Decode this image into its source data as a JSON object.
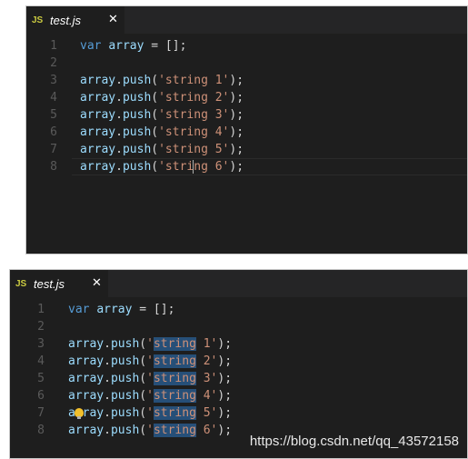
{
  "editors": [
    {
      "tab": {
        "badge": "JS",
        "filename": "test.js",
        "close": "✕"
      },
      "lines": [
        {
          "n": "1",
          "code": [
            {
              "t": "var",
              "c": "kw"
            },
            {
              "t": " ",
              "c": "p"
            },
            {
              "t": "array",
              "c": "id"
            },
            {
              "t": " = [];",
              "c": "p"
            }
          ]
        },
        {
          "n": "2",
          "code": []
        },
        {
          "n": "3",
          "code": [
            {
              "t": "array",
              "c": "id"
            },
            {
              "t": ".",
              "c": "p"
            },
            {
              "t": "push",
              "c": "id"
            },
            {
              "t": "(",
              "c": "p"
            },
            {
              "t": "'string 1'",
              "c": "str"
            },
            {
              "t": ");",
              "c": "p"
            }
          ]
        },
        {
          "n": "4",
          "code": [
            {
              "t": "array",
              "c": "id"
            },
            {
              "t": ".",
              "c": "p"
            },
            {
              "t": "push",
              "c": "id"
            },
            {
              "t": "(",
              "c": "p"
            },
            {
              "t": "'string 2'",
              "c": "str"
            },
            {
              "t": ");",
              "c": "p"
            }
          ]
        },
        {
          "n": "5",
          "code": [
            {
              "t": "array",
              "c": "id"
            },
            {
              "t": ".",
              "c": "p"
            },
            {
              "t": "push",
              "c": "id"
            },
            {
              "t": "(",
              "c": "p"
            },
            {
              "t": "'string 3'",
              "c": "str"
            },
            {
              "t": ");",
              "c": "p"
            }
          ]
        },
        {
          "n": "6",
          "code": [
            {
              "t": "array",
              "c": "id"
            },
            {
              "t": ".",
              "c": "p"
            },
            {
              "t": "push",
              "c": "id"
            },
            {
              "t": "(",
              "c": "p"
            },
            {
              "t": "'string 4'",
              "c": "str"
            },
            {
              "t": ");",
              "c": "p"
            }
          ]
        },
        {
          "n": "7",
          "code": [
            {
              "t": "array",
              "c": "id"
            },
            {
              "t": ".",
              "c": "p"
            },
            {
              "t": "push",
              "c": "id"
            },
            {
              "t": "(",
              "c": "p"
            },
            {
              "t": "'string 5'",
              "c": "str"
            },
            {
              "t": ");",
              "c": "p"
            }
          ]
        },
        {
          "n": "8",
          "code": [
            {
              "t": "array",
              "c": "id"
            },
            {
              "t": ".",
              "c": "p"
            },
            {
              "t": "push",
              "c": "id"
            },
            {
              "t": "(",
              "c": "p"
            },
            {
              "t": "'string 6'",
              "c": "str"
            },
            {
              "t": ");",
              "c": "p"
            }
          ]
        }
      ],
      "current_line": 8
    },
    {
      "tab": {
        "badge": "JS",
        "filename": "test.js",
        "close": "✕"
      },
      "lines": [
        {
          "n": "1",
          "code": [
            {
              "t": "var",
              "c": "kw"
            },
            {
              "t": " ",
              "c": "p"
            },
            {
              "t": "array",
              "c": "id"
            },
            {
              "t": " = [];",
              "c": "p"
            }
          ]
        },
        {
          "n": "2",
          "code": []
        },
        {
          "n": "3",
          "code": [
            {
              "t": "array",
              "c": "id"
            },
            {
              "t": ".",
              "c": "p"
            },
            {
              "t": "push",
              "c": "id"
            },
            {
              "t": "(",
              "c": "p"
            },
            {
              "t": "'",
              "c": "str"
            },
            {
              "t": "string",
              "c": "str sel"
            },
            {
              "t": " 1'",
              "c": "str"
            },
            {
              "t": ");",
              "c": "p"
            }
          ]
        },
        {
          "n": "4",
          "code": [
            {
              "t": "array",
              "c": "id"
            },
            {
              "t": ".",
              "c": "p"
            },
            {
              "t": "push",
              "c": "id"
            },
            {
              "t": "(",
              "c": "p"
            },
            {
              "t": "'",
              "c": "str"
            },
            {
              "t": "string",
              "c": "str sel"
            },
            {
              "t": " 2'",
              "c": "str"
            },
            {
              "t": ");",
              "c": "p"
            }
          ]
        },
        {
          "n": "5",
          "code": [
            {
              "t": "array",
              "c": "id"
            },
            {
              "t": ".",
              "c": "p"
            },
            {
              "t": "push",
              "c": "id"
            },
            {
              "t": "(",
              "c": "p"
            },
            {
              "t": "'",
              "c": "str"
            },
            {
              "t": "string",
              "c": "str sel"
            },
            {
              "t": " 3'",
              "c": "str"
            },
            {
              "t": ");",
              "c": "p"
            }
          ]
        },
        {
          "n": "6",
          "code": [
            {
              "t": "array",
              "c": "id"
            },
            {
              "t": ".",
              "c": "p"
            },
            {
              "t": "push",
              "c": "id"
            },
            {
              "t": "(",
              "c": "p"
            },
            {
              "t": "'",
              "c": "str"
            },
            {
              "t": "string",
              "c": "str sel"
            },
            {
              "t": " 4'",
              "c": "str"
            },
            {
              "t": ");",
              "c": "p"
            }
          ]
        },
        {
          "n": "7",
          "code": [
            {
              "t": "array",
              "c": "id"
            },
            {
              "t": ".",
              "c": "p"
            },
            {
              "t": "push",
              "c": "id"
            },
            {
              "t": "(",
              "c": "p"
            },
            {
              "t": "'",
              "c": "str"
            },
            {
              "t": "string",
              "c": "str sel"
            },
            {
              "t": " 5'",
              "c": "str"
            },
            {
              "t": ");",
              "c": "p"
            }
          ]
        },
        {
          "n": "8",
          "code": [
            {
              "t": "array",
              "c": "id"
            },
            {
              "t": ".",
              "c": "p"
            },
            {
              "t": "push",
              "c": "id"
            },
            {
              "t": "(",
              "c": "p"
            },
            {
              "t": "'",
              "c": "str"
            },
            {
              "t": "string",
              "c": "str sel"
            },
            {
              "t": " 6'",
              "c": "str"
            },
            {
              "t": ");",
              "c": "p"
            }
          ]
        }
      ],
      "lightbulb_line": 7
    }
  ],
  "watermark": "https://blog.csdn.net/qq_43572158",
  "colors": {
    "background": "#1e1e1e",
    "keyword": "#569cd6",
    "identifier": "#9cdcfe",
    "string": "#ce9178",
    "selection": "#264f78"
  }
}
